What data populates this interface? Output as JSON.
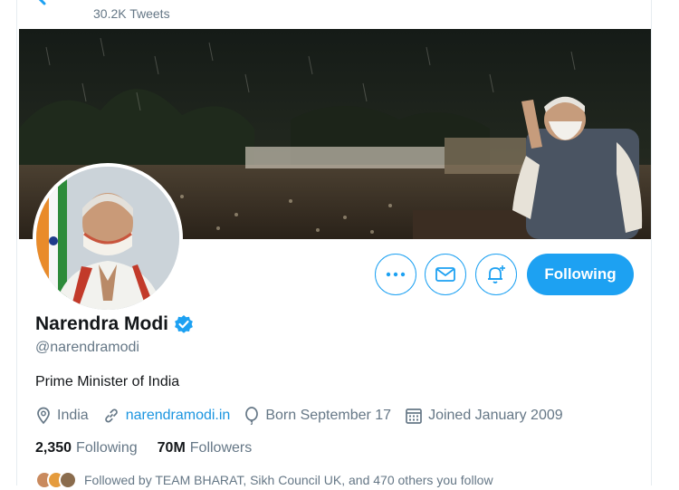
{
  "header": {
    "tweets_count": "30.2K Tweets",
    "back_icon": "back-arrow-icon"
  },
  "profile": {
    "name": "Narendra Modi",
    "verified": true,
    "handle": "@narendramodi",
    "bio": "Prime Minister of India",
    "location": "India",
    "website": "narendramodi.in",
    "birthday": "Born September 17",
    "joined": "Joined January 2009"
  },
  "actions": {
    "more_icon": "more-options-icon",
    "message_icon": "mail-icon",
    "notify_icon": "bell-plus-icon",
    "follow_label": "Following"
  },
  "stats": {
    "following_count": "2,350",
    "following_label": "Following",
    "followers_count": "70M",
    "followers_label": "Followers"
  },
  "followed_by": "Followed by TEAM BHARAT, Sikh Council UK, and 470 others you follow",
  "colors": {
    "accent": "#1da1f2",
    "link": "#1b95e0",
    "secondary_text": "#657786",
    "primary_text": "#14171a"
  }
}
